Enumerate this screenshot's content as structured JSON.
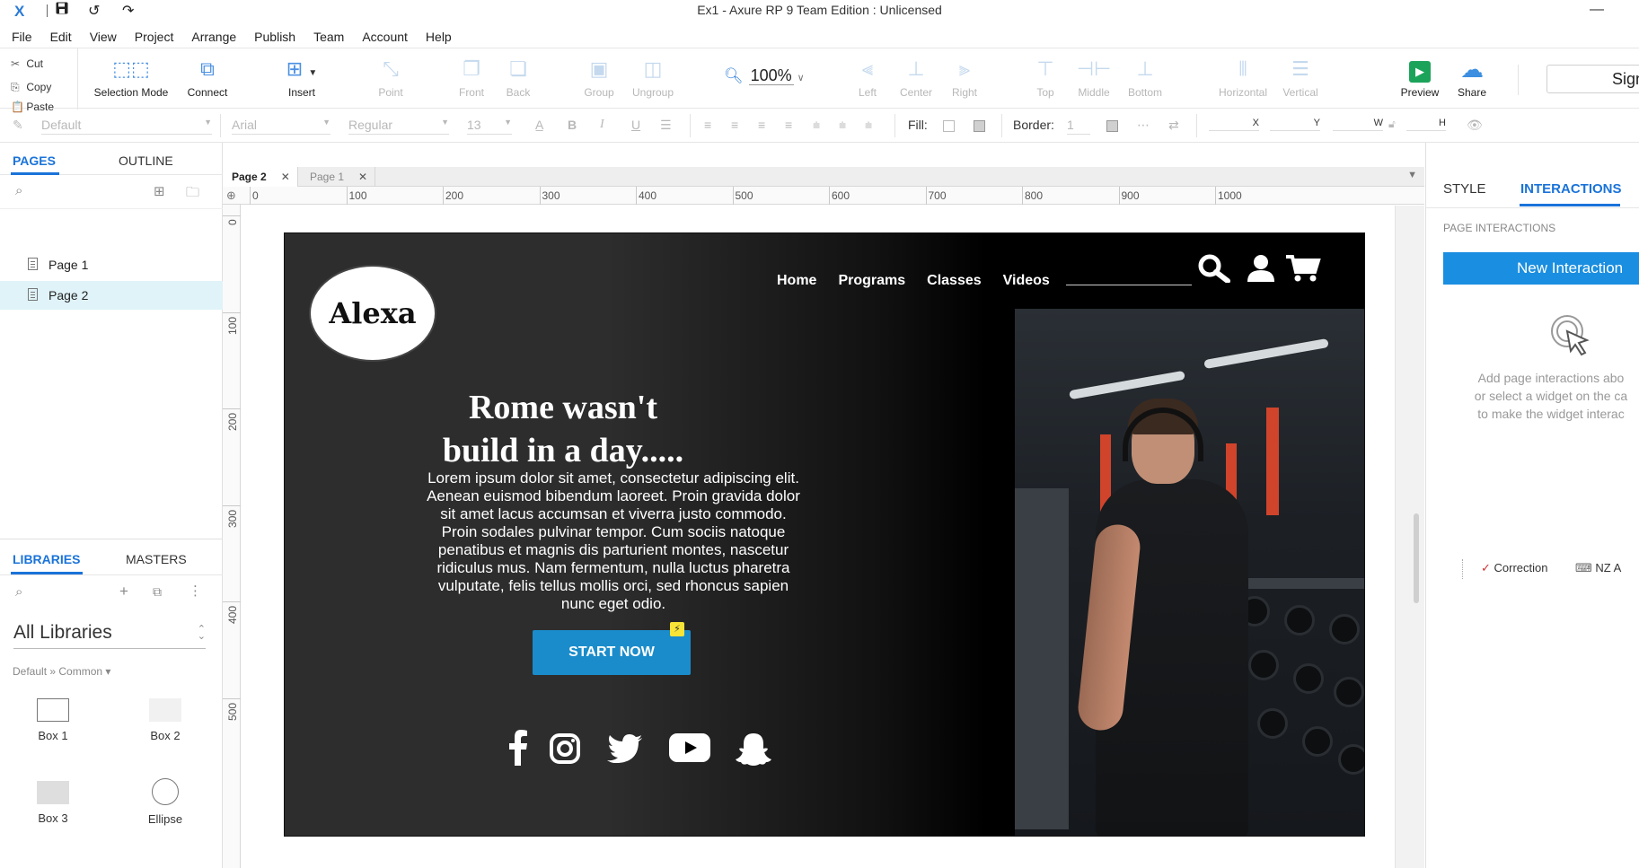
{
  "titlebar": {
    "app_logo": "X",
    "title": "Ex1 - Axure RP 9 Team Edition : Unlicensed",
    "minimize": "—"
  },
  "menubar": [
    "File",
    "Edit",
    "View",
    "Project",
    "Arrange",
    "Publish",
    "Team",
    "Account",
    "Help"
  ],
  "clipboard": {
    "cut": "Cut",
    "copy": "Copy",
    "paste": "Paste"
  },
  "toolbar": {
    "selection_mode": "Selection Mode",
    "connect": "Connect",
    "insert": "Insert",
    "point": "Point",
    "front": "Front",
    "back": "Back",
    "group": "Group",
    "ungroup": "Ungroup",
    "zoom": "100%",
    "left": "Left",
    "center": "Center",
    "right": "Right",
    "top": "Top",
    "middle": "Middle",
    "bottom": "Bottom",
    "horizontal": "Horizontal",
    "vertical": "Vertical",
    "preview": "Preview",
    "share": "Share",
    "sign_in": "Sign"
  },
  "formatbar": {
    "style": "Default",
    "font": "Arial",
    "weight": "Regular",
    "size": "13",
    "fill_label": "Fill:",
    "border_label": "Border:",
    "border_value": "1",
    "x_label": "X",
    "y_label": "Y",
    "w_label": "W",
    "h_label": "H"
  },
  "leftpanel": {
    "tab_pages": "PAGES",
    "tab_outline": "OUTLINE",
    "pages": [
      "Page 1",
      "Page 2"
    ],
    "selected_page": "Page 2",
    "tab_libraries": "LIBRARIES",
    "tab_masters": "MASTERS",
    "library_select": "All Libraries",
    "library_path": "Default » Common ▾",
    "widgets": [
      "Box 1",
      "Box 2",
      "Box 3",
      "Ellipse"
    ]
  },
  "doc_tabs": [
    {
      "label": "Page 2",
      "active": true
    },
    {
      "label": "Page 1",
      "active": false
    }
  ],
  "ruler": {
    "top_labels": [
      "0",
      "100",
      "200",
      "300",
      "400",
      "500",
      "600",
      "700",
      "800",
      "900",
      "1000"
    ],
    "left_labels": [
      "0",
      "100",
      "200",
      "300",
      "400",
      "500"
    ]
  },
  "mockup": {
    "logo": "Alexa",
    "nav": [
      "Home",
      "Programs",
      "Classes",
      "Videos"
    ],
    "hero_title": "Rome wasn't build in a day.....",
    "hero_body": "Lorem ipsum dolor sit amet, consectetur adipiscing elit. Aenean euismod bibendum laoreet. Proin gravida dolor sit amet lacus accumsan et viverra justo commodo. Proin sodales pulvinar tempor. Cum sociis natoque penatibus et magnis dis parturient montes, nascetur ridiculus mus. Nam fermentum, nulla luctus pharetra vulputate, felis tellus mollis orci, sed rhoncus sapien nunc eget odio.",
    "cta": "START NOW",
    "socials": [
      "facebook-icon",
      "instagram-icon",
      "twitter-icon",
      "youtube-icon",
      "snapchat-icon"
    ]
  },
  "rightpanel": {
    "tab_style": "STYLE",
    "tab_interactions": "INTERACTIONS",
    "page_interactions": "PAGE INTERACTIONS",
    "new_interaction": "New Interaction",
    "help_line1": "Add page interactions abo",
    "help_line2": "or select a widget on the ca",
    "help_line3": "to make the widget interac",
    "bottom_item1": "Correction",
    "bottom_item2": "NZ A"
  },
  "colors": {
    "accent": "#1a73d9",
    "new_interaction_bg": "#1a8ee0",
    "cta_bg": "#1a8ccb",
    "preview_green": "#1ca35a",
    "page_selected_bg": "#dff3f8"
  }
}
